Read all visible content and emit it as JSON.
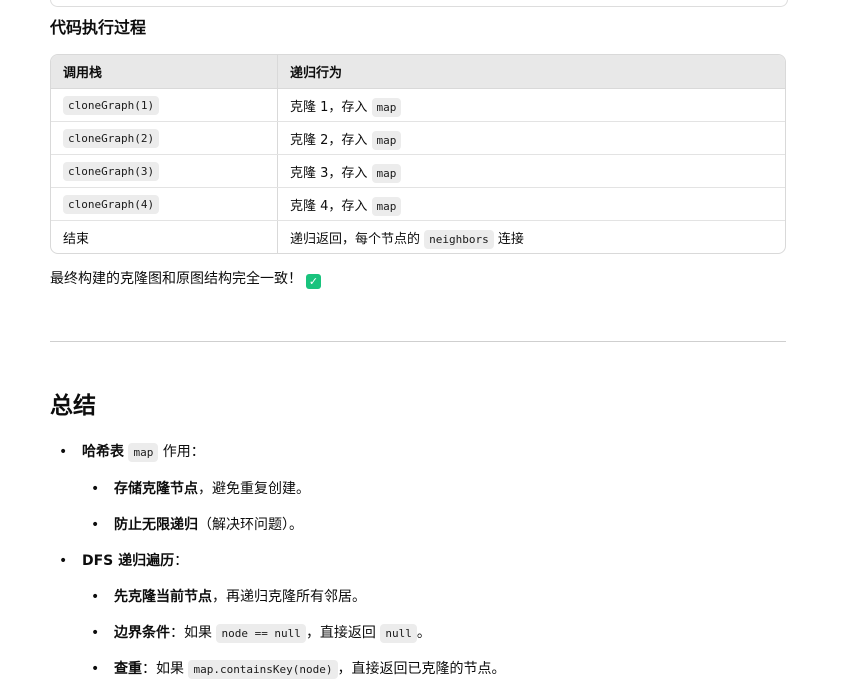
{
  "section": {
    "title": "代码执行过程"
  },
  "table": {
    "headers": [
      "调用栈",
      "递归行为"
    ],
    "rows": [
      {
        "call": "cloneGraph(1)",
        "action_prefix": "克隆 1，存入",
        "action_code": "map",
        "action_suffix": ""
      },
      {
        "call": "cloneGraph(2)",
        "action_prefix": "克隆 2，存入",
        "action_code": "map",
        "action_suffix": ""
      },
      {
        "call": "cloneGraph(3)",
        "action_prefix": "克隆 3，存入",
        "action_code": "map",
        "action_suffix": ""
      },
      {
        "call": "cloneGraph(4)",
        "action_prefix": "克隆 4，存入",
        "action_code": "map",
        "action_suffix": ""
      },
      {
        "call_text": "结束",
        "action_prefix": "递归返回，每个节点的",
        "action_code": "neighbors",
        "action_suffix": "连接"
      }
    ]
  },
  "final_line": {
    "text": "最终构建的克隆图和原图结构完全一致！",
    "icon": "check-mark-icon",
    "icon_color": "#19c37d"
  },
  "summary": {
    "heading": "总结",
    "items": [
      {
        "bold": "哈希表",
        "code": "map",
        "rest": "作用：",
        "children": [
          {
            "bold": "存储克隆节点",
            "rest": "，避免重复创建。"
          },
          {
            "bold": "防止无限递归",
            "rest": "（解决环问题）。"
          }
        ]
      },
      {
        "bold": "DFS 递归遍历",
        "rest": "：",
        "children": [
          {
            "bold": "先克隆当前节点",
            "rest": "，再递归克隆所有邻居。"
          },
          {
            "bold": "边界条件",
            "rest_a": "：如果",
            "code_a": "node == null",
            "rest_b": "，直接返回",
            "code_b": "null",
            "rest_c": "。"
          },
          {
            "bold": "查重",
            "rest_a": "：如果",
            "code_a": "map.containsKey(node)",
            "rest_b": "，直接返回已克隆的节点。"
          }
        ]
      }
    ]
  }
}
